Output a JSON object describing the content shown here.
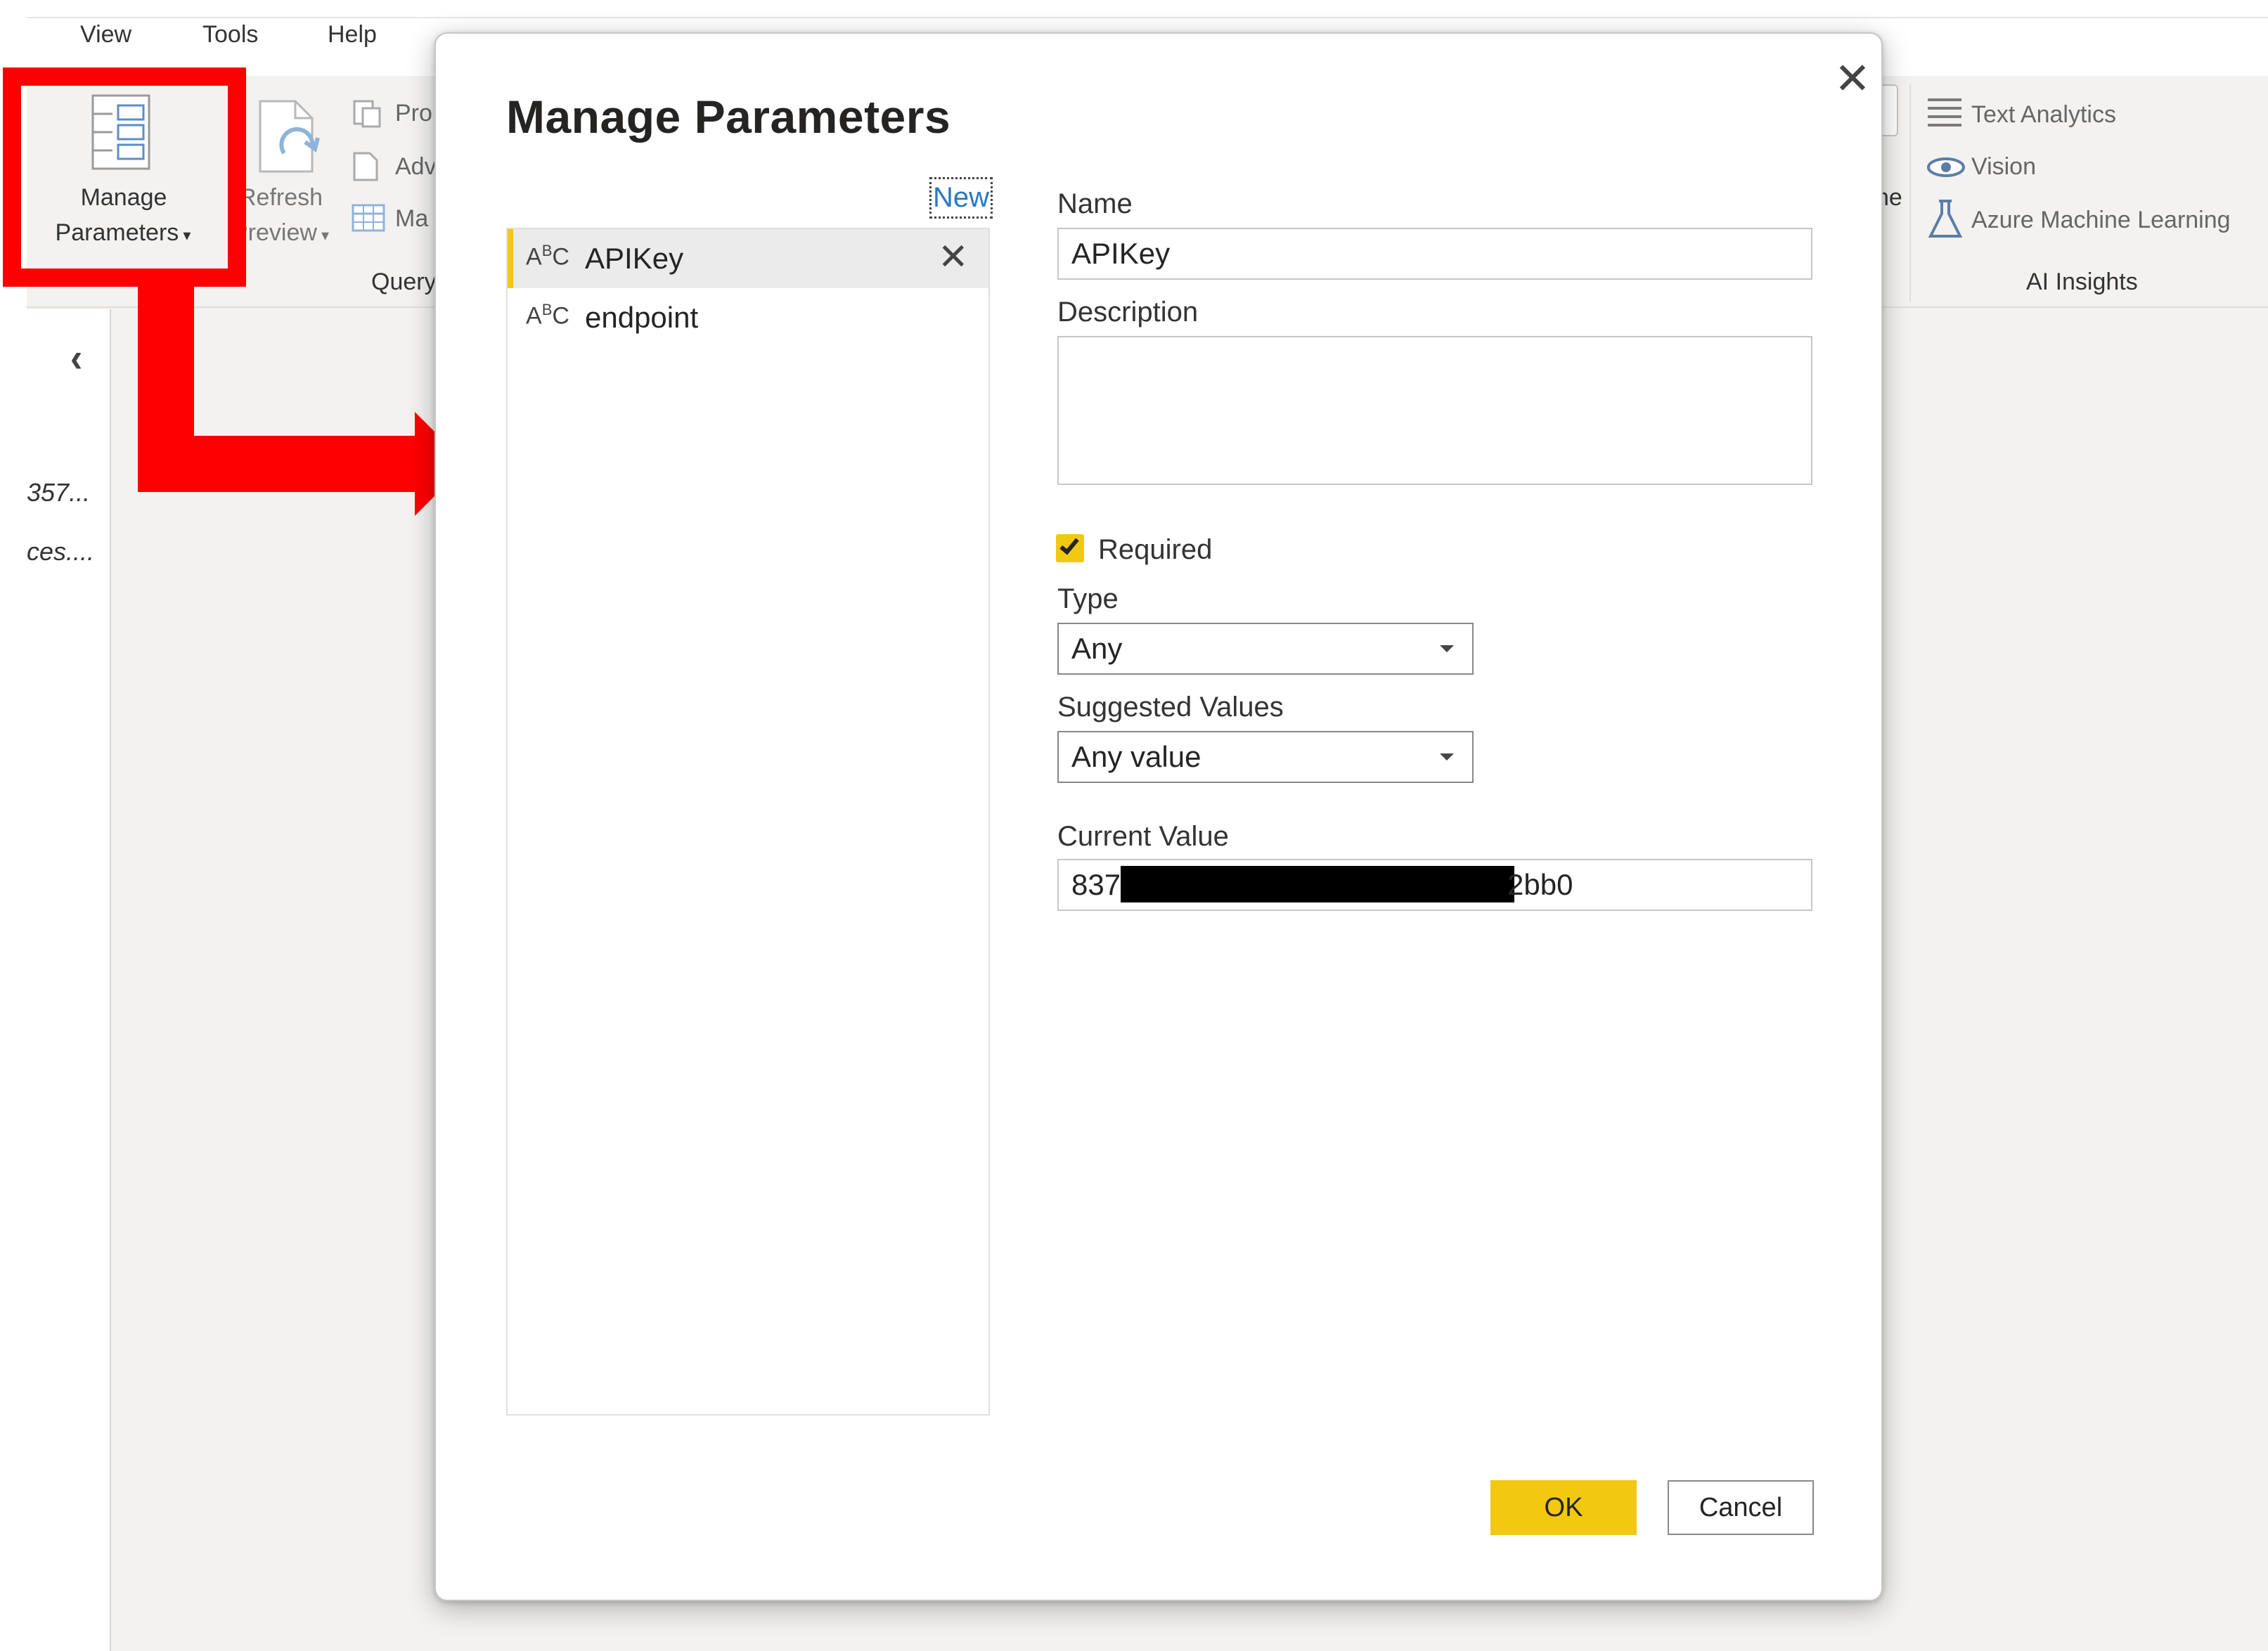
{
  "menubar": {
    "items": [
      "View",
      "Tools",
      "Help"
    ]
  },
  "ribbon": {
    "manage_parameters": {
      "line1": "Manage",
      "line2": "Parameters"
    },
    "refresh_preview": {
      "line1": "Refresh",
      "line2": "Preview"
    },
    "query_items": [
      "Pro",
      "Adv",
      "Ma"
    ],
    "query_group_label": "Query",
    "partial_right": "ne",
    "ai": {
      "items": [
        "Text Analytics",
        "Vision",
        "Azure Machine Learning"
      ],
      "group_label": "AI Insights"
    }
  },
  "queries_pane": {
    "items": [
      "357...",
      "ces...."
    ]
  },
  "dialog": {
    "title": "Manage Parameters",
    "new_link": "New",
    "parameters": [
      {
        "type_icon": "ABC",
        "name": "APIKey",
        "selected": true
      },
      {
        "type_icon": "ABC",
        "name": "endpoint",
        "selected": false
      }
    ],
    "form": {
      "name_label": "Name",
      "name_value": "APIKey",
      "description_label": "Description",
      "description_value": "",
      "required_label": "Required",
      "required_checked": true,
      "type_label": "Type",
      "type_value": "Any",
      "suggested_label": "Suggested Values",
      "suggested_value": "Any value",
      "current_label": "Current Value",
      "current_value_start": "837",
      "current_value_end": "2bb0"
    },
    "ok_label": "OK",
    "cancel_label": "Cancel"
  },
  "colors": {
    "accent": "#f2c811",
    "highlight": "#ff0000",
    "link": "#2b78c2"
  }
}
